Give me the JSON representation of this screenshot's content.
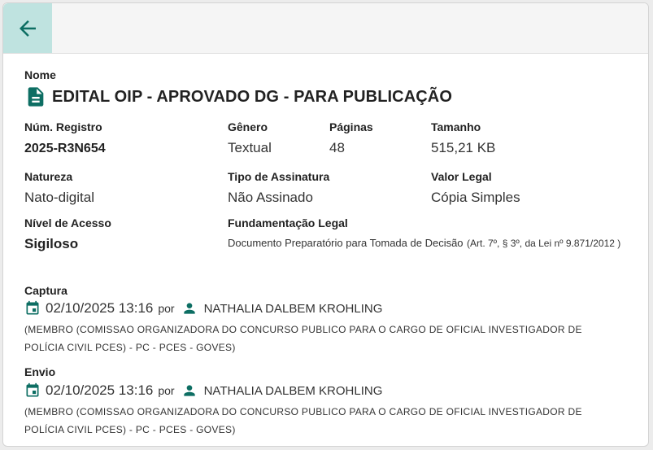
{
  "icons": {
    "back": "arrow-left-icon",
    "document": "description-icon",
    "calendar": "calendar-icon",
    "user": "person-icon"
  },
  "colors": {
    "accent": "#0d6e63",
    "back_button_bg": "#bfe3e0"
  },
  "document": {
    "name_label": "Nome",
    "name": "EDITAL OIP - APROVADO DG - PARA PUBLICAÇÃO",
    "registro_label": "Núm. Registro",
    "registro": "2025-R3N654",
    "genero_label": "Gênero",
    "genero": "Textual",
    "paginas_label": "Páginas",
    "paginas": "48",
    "tamanho_label": "Tamanho",
    "tamanho": "515,21 KB",
    "natureza_label": "Natureza",
    "natureza": "Nato-digital",
    "assinatura_label": "Tipo de Assinatura",
    "assinatura": "Não Assinado",
    "valor_legal_label": "Valor Legal",
    "valor_legal": "Cópia Simples",
    "acesso_label": "Nível de Acesso",
    "acesso": "Sigiloso",
    "fundamentacao_label": "Fundamentação Legal",
    "fundamentacao_main": "Documento Preparatório para Tomada de Decisão",
    "fundamentacao_ref": "(Art. 7º, § 3º, da Lei nº 9.871/2012 )"
  },
  "captura": {
    "label": "Captura",
    "datetime": "02/10/2025 13:16",
    "por": "por",
    "user": "NATHALIA DALBEM KROHLING",
    "org_line1": "(MEMBRO (COMISSAO ORGANIZADORA DO CONCURSO PUBLICO PARA O CARGO DE OFICIAL INVESTIGADOR DE",
    "org_line2": "POLÍCIA CIVIL PCES) - PC - PCES - GOVES)"
  },
  "envio": {
    "label": "Envio",
    "datetime": "02/10/2025 13:16",
    "por": "por",
    "user": "NATHALIA DALBEM KROHLING",
    "org_line1": "(MEMBRO (COMISSAO ORGANIZADORA DO CONCURSO PUBLICO PARA O CARGO DE OFICIAL INVESTIGADOR DE",
    "org_line2": "POLÍCIA CIVIL PCES) - PC - PCES - GOVES)"
  }
}
